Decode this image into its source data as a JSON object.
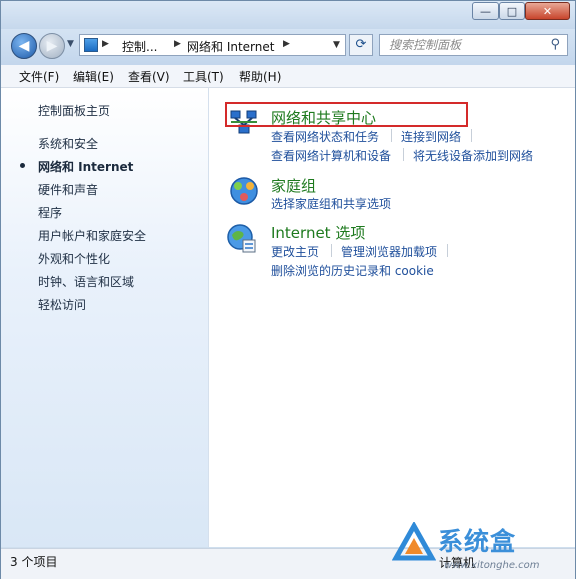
{
  "window": {
    "controls": {
      "minimize": "—",
      "maximize": "□",
      "close": "✕"
    }
  },
  "address_bar": {
    "crumbs": [
      "控制...",
      "网络和 Internet"
    ],
    "refresh_icon": "refresh-icon"
  },
  "search": {
    "placeholder": "搜索控制面板"
  },
  "menubar": {
    "items": [
      "文件(F)",
      "编辑(E)",
      "查看(V)",
      "工具(T)",
      "帮助(H)"
    ]
  },
  "sidebar": {
    "home": "控制面板主页",
    "items": [
      "系统和安全",
      "网络和 Internet",
      "硬件和声音",
      "程序",
      "用户帐户和家庭安全",
      "外观和个性化",
      "时钟、语言和区域",
      "轻松访问"
    ],
    "current_index": 1
  },
  "categories": [
    {
      "title": "网络和共享中心",
      "icon": "network-sharing-center-icon",
      "tasks": [
        "查看网络状态和任务",
        "连接到网络",
        "查看网络计算机和设备",
        "将无线设备添加到网络"
      ]
    },
    {
      "title": "家庭组",
      "icon": "homegroup-icon",
      "tasks": [
        "选择家庭组和共享选项"
      ]
    },
    {
      "title": "Internet 选项",
      "icon": "internet-options-icon",
      "tasks": [
        "更改主页",
        "管理浏览器加载项",
        "删除浏览的历史记录和 cookie"
      ]
    }
  ],
  "status_bar": {
    "item_count": "3 个项目",
    "computer_label": "计算机"
  },
  "watermark": {
    "text": "系统盒",
    "url": "www.xitonghe.com"
  },
  "colors": {
    "category_title": "#1e7a1e",
    "task_link": "#1f4f9b",
    "highlight": "#d42a2a"
  }
}
